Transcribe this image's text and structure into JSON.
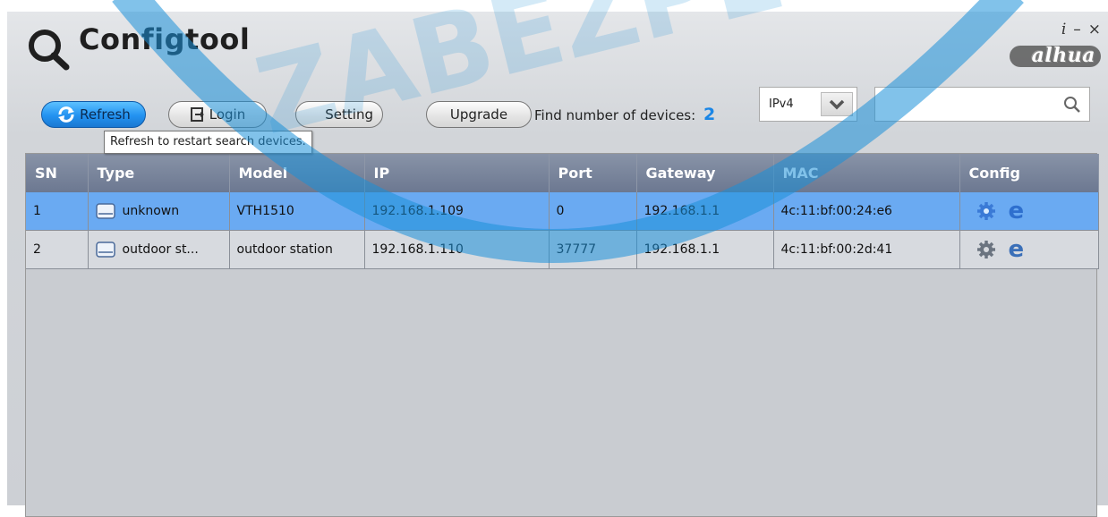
{
  "app": {
    "title": "Configtool",
    "brand": "alhua",
    "info_icon": "i",
    "minimize_icon": "–",
    "close_icon": "×"
  },
  "toolbar": {
    "refresh_label": "Refresh",
    "login_label": "Login",
    "setting_label": "Setting",
    "upgrade_label": "Upgrade",
    "found_label": "Find number of devices:",
    "found_count": "2",
    "ip_version": "IPv4",
    "search_value": "",
    "tooltip": "Refresh to restart search devices."
  },
  "table": {
    "columns": [
      "SN",
      "Type",
      "Model",
      "IP",
      "Port",
      "Gateway",
      "MAC",
      "Config"
    ],
    "rows": [
      {
        "sn": "1",
        "type": "unknown",
        "model": "VTH1510",
        "ip": "192.168.1.109",
        "port": "0",
        "gateway": "192.168.1.1",
        "mac": "4c:11:bf:00:24:e6",
        "selected": true
      },
      {
        "sn": "2",
        "type": "outdoor st...",
        "model": "outdoor station",
        "ip": "192.168.1.110",
        "port": "37777",
        "gateway": "192.168.1.1",
        "mac": "4c:11:bf:00:2d:41",
        "selected": false
      }
    ]
  },
  "colors": {
    "accent": "#1a86e6",
    "selected_row": "#6aaaf2",
    "header": "#6c7891"
  }
}
